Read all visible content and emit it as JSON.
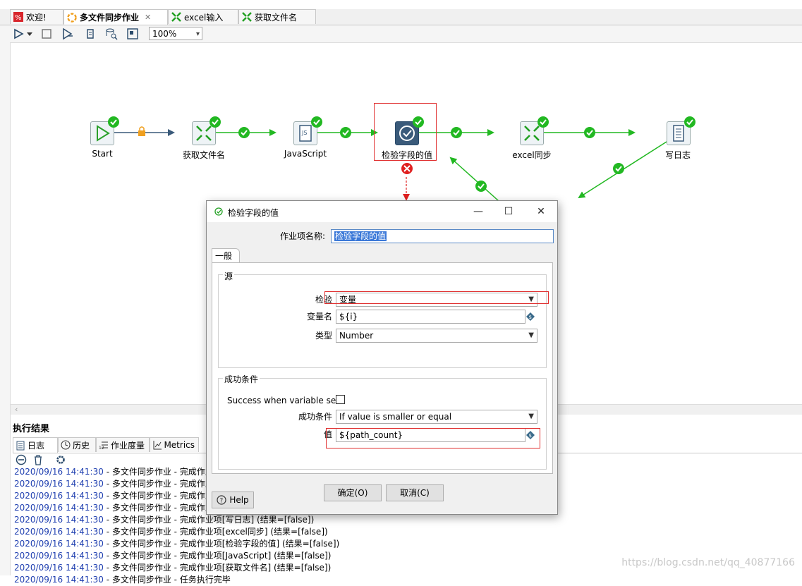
{
  "tabs": [
    {
      "label": "欢迎!"
    },
    {
      "label": "多文件同步作业"
    },
    {
      "label": "excel输入"
    },
    {
      "label": "获取文件名"
    }
  ],
  "toolbar": {
    "zoom": "100%"
  },
  "workflow": {
    "nodes": [
      {
        "label": "Start"
      },
      {
        "label": "获取文件名"
      },
      {
        "label": "JavaScript"
      },
      {
        "label": "检验字段的值"
      },
      {
        "label": "excel同步"
      },
      {
        "label": "写日志"
      }
    ]
  },
  "results": {
    "title": "执行结果",
    "tabs": [
      {
        "label": "日志"
      },
      {
        "label": "历史"
      },
      {
        "label": "作业度量"
      },
      {
        "label": "Metrics"
      }
    ],
    "log": [
      {
        "ts": "2020/09/16 14:41:30",
        "msg": " - 多文件同步作业 - 完成作业"
      },
      {
        "ts": "2020/09/16 14:41:30",
        "msg": " - 多文件同步作业 - 完成作业"
      },
      {
        "ts": "2020/09/16 14:41:30",
        "msg": " - 多文件同步作业 - 完成作业"
      },
      {
        "ts": "2020/09/16 14:41:30",
        "msg": " - 多文件同步作业 - 完成作业"
      },
      {
        "ts": "2020/09/16 14:41:30",
        "msg": " - 多文件同步作业 - 完成作业项[写日志] (结果=[false])"
      },
      {
        "ts": "2020/09/16 14:41:30",
        "msg": " - 多文件同步作业 - 完成作业项[excel同步] (结果=[false])"
      },
      {
        "ts": "2020/09/16 14:41:30",
        "msg": " - 多文件同步作业 - 完成作业项[检验字段的值] (结果=[false])"
      },
      {
        "ts": "2020/09/16 14:41:30",
        "msg": " - 多文件同步作业 - 完成作业项[JavaScript] (结果=[false])"
      },
      {
        "ts": "2020/09/16 14:41:30",
        "msg": " - 多文件同步作业 - 完成作业项[获取文件名] (结果=[false])"
      },
      {
        "ts": "2020/09/16 14:41:30",
        "msg": " - 多文件同步作业 - 任务执行完毕"
      }
    ]
  },
  "dialog": {
    "title": "检验字段的值",
    "name_label": "作业项名称:",
    "name_value": "检验字段的值",
    "tab_general": "一般",
    "source": {
      "group": "源",
      "check_label": "检验",
      "check_value": "变量",
      "varname_label": "变量名",
      "varname_value": "${i}",
      "type_label": "类型",
      "type_value": "Number"
    },
    "success": {
      "group": "成功条件",
      "var_set_label": "Success when variable set",
      "var_set_checked": false,
      "cond_label": "成功条件",
      "cond_value": "If value is smaller or equal",
      "value_label": "值",
      "value_value": "${path_count}"
    },
    "buttons": {
      "help": "Help",
      "ok": "确定(O)",
      "cancel": "取消(C)"
    }
  },
  "watermark": "https://blog.csdn.net/qq_40877166",
  "colors": {
    "link": "#22b822",
    "check": "#22b822",
    "error": "#e02020",
    "timestamp": "#1f3fb0",
    "highlight": "#e03030"
  }
}
